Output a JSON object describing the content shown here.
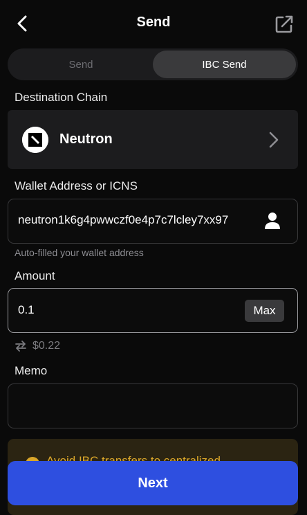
{
  "header": {
    "title": "Send",
    "back_icon": "chevron-left-icon",
    "external_icon": "external-link-icon"
  },
  "tabs": [
    {
      "label": "Send",
      "active": false
    },
    {
      "label": "IBC Send",
      "active": true
    }
  ],
  "destination": {
    "label": "Destination Chain",
    "chain_name": "Neutron",
    "logo_icon": "neutron-logo-icon",
    "chevron_icon": "chevron-right-icon"
  },
  "wallet": {
    "label": "Wallet Address or ICNS",
    "value": "neutron1k6g4pwwczf0e4p7c7lcley7xx97",
    "contact_icon": "person-icon",
    "hint": "Auto-filled your wallet address"
  },
  "amount": {
    "label": "Amount",
    "value": "0.1",
    "max_label": "Max",
    "fiat_value": "$0.22",
    "swap_icon": "swap-arrows-icon"
  },
  "memo": {
    "label": "Memo",
    "value": ""
  },
  "warning": {
    "text": "Avoid IBC transfers to centralized"
  },
  "footer": {
    "next_label": "Next"
  },
  "colors": {
    "background": "#0a0a0a",
    "card": "#1c1c1e",
    "accent": "#2e4fe0",
    "warning": "#d9a62a"
  }
}
